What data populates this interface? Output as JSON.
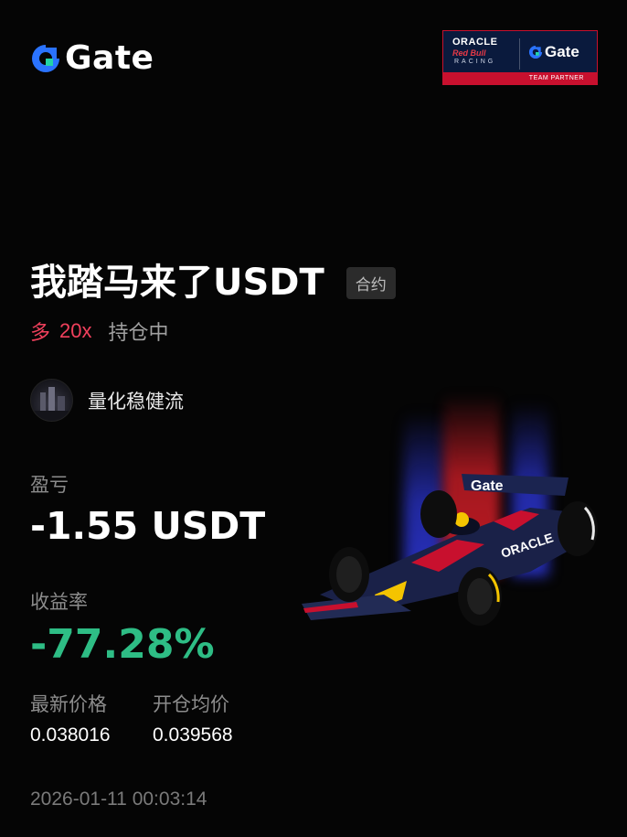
{
  "brand": {
    "logo_text": "Gate",
    "accent_color": "#1f6bff"
  },
  "partner_badge": {
    "oracle": "ORACLE",
    "redbull": "Red Bull",
    "racing": "RACING",
    "gate": "Gate",
    "team_partner": "TEAM PARTNER"
  },
  "position": {
    "pair": "我踏马来了USDT",
    "type_tag": "合约",
    "side": "多",
    "leverage": "20x",
    "status": "持仓中"
  },
  "user": {
    "name": "量化稳健流"
  },
  "pnl": {
    "label": "盈亏",
    "value": "-1.55 USDT"
  },
  "roi": {
    "label": "收益率",
    "value": "-77.28%",
    "color": "#2ebd85"
  },
  "prices": {
    "last_label": "最新价格",
    "last_value": "0.038016",
    "entry_label": "开仓均价",
    "entry_value": "0.039568"
  },
  "timestamp": "2026-01-11 00:03:14",
  "car_livery": "Gate"
}
